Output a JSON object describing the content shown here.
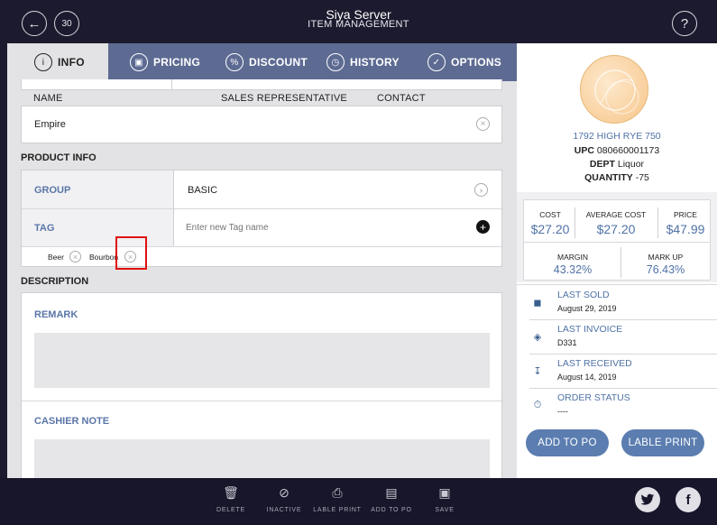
{
  "header": {
    "title": "Siya Server",
    "subtitle": "ITEM MANAGEMENT",
    "calendar_day": "30",
    "help": "?"
  },
  "tabs": [
    {
      "label": "INFO",
      "icon": "info-icon"
    },
    {
      "label": "PRICING",
      "icon": "money-icon"
    },
    {
      "label": "DISCOUNT",
      "icon": "percent-icon"
    },
    {
      "label": "HISTORY",
      "icon": "clock-icon"
    },
    {
      "label": "OPTIONS",
      "icon": "check-icon"
    }
  ],
  "vendor": {
    "col_name": "NAME",
    "col_rep": "SALES REPRESENTATIVE",
    "col_contact": "CONTACT",
    "name": "Empire"
  },
  "product_info": {
    "title": "PRODUCT INFO",
    "group_label": "GROUP",
    "group_value": "BASIC",
    "tag_label": "TAG",
    "tag_placeholder": "Enter new Tag name",
    "tags": [
      "Beer",
      "Bourbon"
    ]
  },
  "description": {
    "title": "DESCRIPTION",
    "remark_label": "REMARK",
    "cashier_note_label": "CASHIER NOTE"
  },
  "item": {
    "name": "1792 HIGH RYE 750",
    "upc_label": "UPC",
    "upc": "080660001173",
    "dept_label": "DEPT",
    "dept": "Liquor",
    "qty_label": "QUANTITY",
    "qty": "-75"
  },
  "stats": {
    "cost_label": "COST",
    "cost": "$27.20",
    "avg_label": "AVERAGE COST",
    "avg": "$27.20",
    "price_label": "PRICE",
    "price": "$47.99",
    "margin_label": "MARGIN",
    "margin": "43.32%",
    "markup_label": "MARK UP",
    "markup": "76.43%"
  },
  "history": [
    {
      "title": "LAST SOLD",
      "value": "August 29, 2019",
      "icon": "bag-icon"
    },
    {
      "title": "LAST INVOICE",
      "value": "D331",
      "icon": "layers-icon"
    },
    {
      "title": "LAST RECEIVED",
      "value": "August 14, 2019",
      "icon": "receive-icon"
    },
    {
      "title": "ORDER STATUS",
      "value": "----",
      "icon": "timer-icon"
    }
  ],
  "actions": {
    "add_to_po": "ADD TO PO",
    "label_print": "LABLE PRINT"
  },
  "toolbar": [
    {
      "label": "DELETE",
      "icon": "trash-icon"
    },
    {
      "label": "INACTIVE",
      "icon": "inactive-icon"
    },
    {
      "label": "LABLE PRINT",
      "icon": "printer-icon"
    },
    {
      "label": "ADD TO PO",
      "icon": "po-icon"
    },
    {
      "label": "SAVE",
      "icon": "save-icon"
    }
  ],
  "social": {
    "twitter": "twitter-icon",
    "facebook": "f"
  },
  "colors": {
    "accent": "#5b7db0",
    "tabbar": "#5d6b93",
    "chrome": "#1c1a2e",
    "highlight": "#e01010"
  }
}
